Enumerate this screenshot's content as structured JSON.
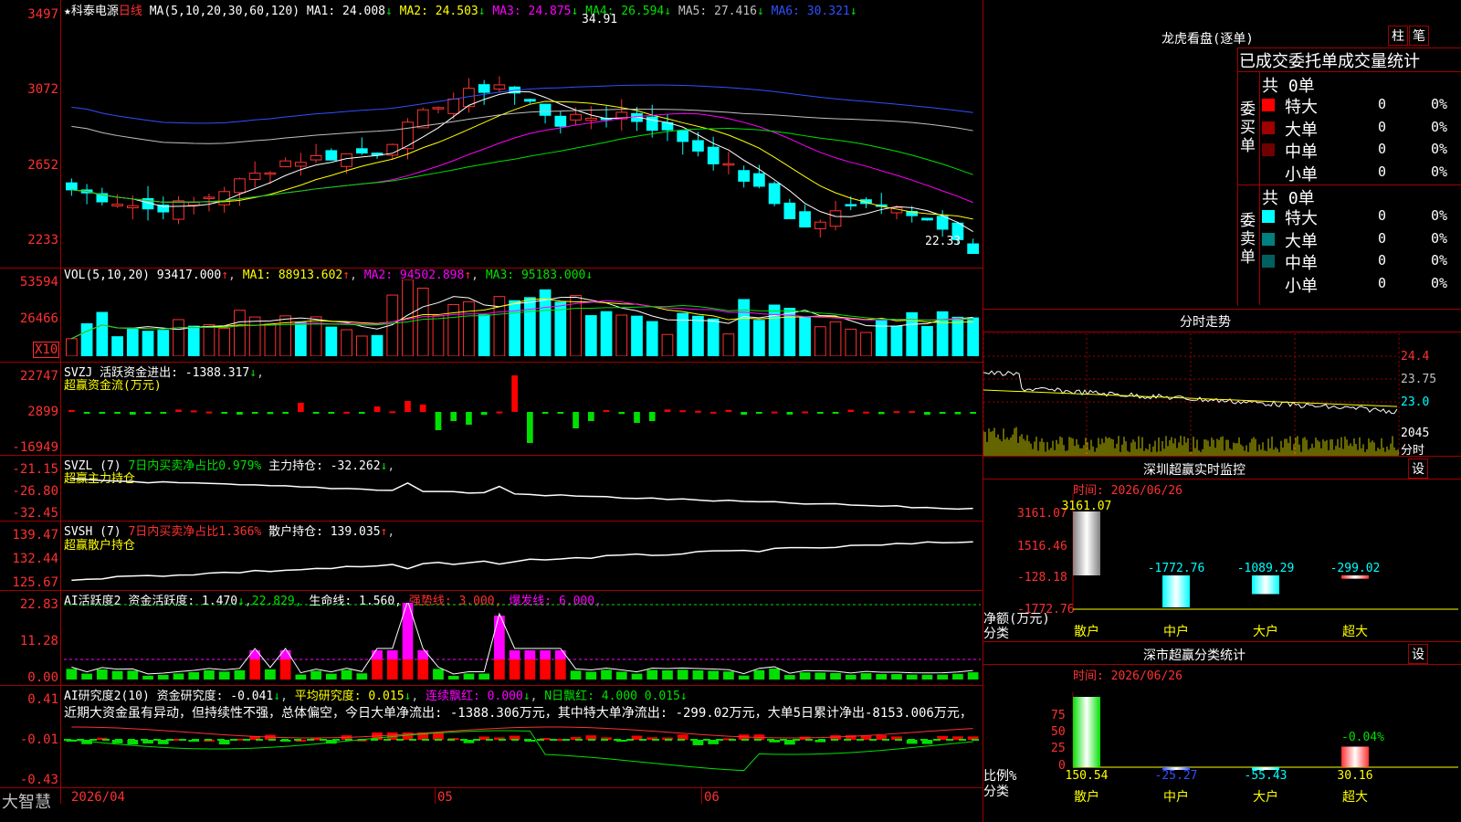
{
  "main_chart": {
    "title_star": "★",
    "stock_name": "科泰电源",
    "period": "日线",
    "ma_label": "MA(5,10,20,30,60,120)",
    "ma_values": [
      {
        "label": "MA1: 24.008",
        "arrow": "↓",
        "color": "#ffffff"
      },
      {
        "label": "MA2: 24.503",
        "arrow": "↓",
        "color": "#ffff00"
      },
      {
        "label": "MA3: 24.875",
        "arrow": "↓",
        "color": "#ff00ff"
      },
      {
        "label": "MA4: 26.594",
        "arrow": "↓",
        "color": "#00e000"
      },
      {
        "label": "MA5: 27.416",
        "arrow": "↓",
        "color": "#c0c0c0"
      },
      {
        "label": "MA6: 30.321",
        "arrow": "↓",
        "color": "#3050ff"
      }
    ],
    "y_ticks": [
      "3497",
      "3072",
      "2652",
      "2233"
    ],
    "high_label": "34.91",
    "low_label": "22.33"
  },
  "vol_pane": {
    "title": "VOL(5,10,20)",
    "value": "93417.000",
    "ma1": "MA1: 88913.602",
    "ma2": "MA2: 94502.898",
    "ma3": "MA3: 95183.000",
    "y_ticks": [
      "53594",
      "26466"
    ],
    "unit": "X10"
  },
  "svzj_pane": {
    "title": "SVZJ",
    "line1": "活跃资金进出: -1388.317",
    "line2": "超赢资金流(万元)",
    "y_ticks": [
      "22747",
      "2899",
      "-16949"
    ]
  },
  "svzl_pane": {
    "title": "SVZL (7)",
    "ratio": "7日内买卖净占比0.979%",
    "hold": "主力持仓: -32.262",
    "line2": "超赢主力持仓",
    "y_ticks": [
      "-21.15",
      "-26.80",
      "-32.45"
    ]
  },
  "svsh_pane": {
    "title": "SVSH (7)",
    "ratio": "7日内买卖净占比1.366%",
    "hold": "散户持仓: 139.035",
    "line2": "超赢散户持仓",
    "y_ticks": [
      "139.47",
      "132.44",
      "125.67"
    ]
  },
  "ai_active_pane": {
    "title": "AI活跃度2",
    "val1": "资金活跃度: 1.470",
    "val2": "22.829,",
    "val3": "生命线: 1.560,",
    "val4": "强势线: 3.000,",
    "val5": "爆发线: 6.000,",
    "y_ticks": [
      "22.83",
      "11.28",
      "0.00"
    ]
  },
  "ai_research_pane": {
    "title": "AI研究度2(10)",
    "val1": "资金研究度: -0.041",
    "val2": "平均研究度: 0.015",
    "val3": "连续飘红: 0.000",
    "val4": "N日飘红: 4.000",
    "val5": "0.015",
    "comment": "近期大资金虽有异动，但持续性不强，总体偏空，今日大单净流出: -1388.306万元，其中特大单净流出: -299.02万元，大单5日累计净出-8153.006万元，",
    "y_ticks": [
      "0.41",
      "-0.01",
      "-0.43"
    ]
  },
  "bottom_axis": {
    "brand": "大智慧",
    "dates": [
      "2026/04",
      "05",
      "06"
    ]
  },
  "longhu": {
    "title": "龙虎看盘(逐单)",
    "btn1": "柱",
    "btn2": "笔",
    "header": "已成交委托单成交量统计",
    "buy_total": "共 0单",
    "buy_side": "委买单",
    "sell_total": "共 0单",
    "sell_side": "委卖单",
    "buy_rows": [
      {
        "label": "特大",
        "color": "#ff0000",
        "qty": "0",
        "pct": "0%"
      },
      {
        "label": "大单",
        "color": "#a00000",
        "qty": "0",
        "pct": "0%"
      },
      {
        "label": "中单",
        "color": "#700000",
        "qty": "0",
        "pct": "0%"
      },
      {
        "label": "小单",
        "color": "",
        "qty": "0",
        "pct": "0%"
      }
    ],
    "sell_rows": [
      {
        "label": "特大",
        "color": "#00ffff",
        "qty": "0",
        "pct": "0%"
      },
      {
        "label": "大单",
        "color": "#008080",
        "qty": "0",
        "pct": "0%"
      },
      {
        "label": "中单",
        "color": "#006060",
        "qty": "0",
        "pct": "0%"
      },
      {
        "label": "小单",
        "color": "",
        "qty": "0",
        "pct": "0%"
      }
    ]
  },
  "intraday": {
    "title": "分时走势",
    "prices": [
      "24.4",
      "23.75",
      "23.0"
    ],
    "vol_label": "2045",
    "vol_unit": "分时"
  },
  "sz_monitor": {
    "title": "深圳超赢实时监控",
    "btn": "设",
    "time": "时间: 2026/06/26",
    "y_ticks": [
      "3161.07",
      "1516.46",
      "-128.18",
      "-1772.76"
    ],
    "ylabel1": "净额(万元)",
    "ylabel2": "分类",
    "categories": [
      "散户",
      "中户",
      "大户",
      "超大"
    ]
  },
  "sz_class": {
    "title": "深市超赢分类统计",
    "btn": "设",
    "time": "时间: 2026/06/26",
    "y_ticks": [
      "75",
      "50",
      "25",
      "0"
    ],
    "ylabel1": "比例%",
    "ylabel2": "分类",
    "above_label": "-0.04%",
    "categories": [
      "散户",
      "中户",
      "大户",
      "超大"
    ]
  },
  "chart_data": [
    {
      "type": "bar",
      "title": "深圳超赢实时监控",
      "categories": [
        "散户",
        "中户",
        "大户",
        "超大"
      ],
      "values": [
        3161.07,
        -1772.76,
        -1089.29,
        -299.02
      ],
      "value_labels": [
        "3161.07",
        "-1772.76",
        "-1089.29",
        "-299.02"
      ],
      "ylabel": "净额(万元)",
      "ylim": [
        -1772.76,
        3161.07
      ]
    },
    {
      "type": "bar",
      "title": "深市超赢分类统计",
      "categories": [
        "散户",
        "中户",
        "大户",
        "超大"
      ],
      "values": [
        150.54,
        -25.27,
        -55.43,
        30.16
      ],
      "value_labels": [
        "150.54",
        "-25.27",
        "-55.43",
        "30.16"
      ],
      "ylabel": "比例%",
      "ylim": [
        0,
        75
      ]
    }
  ]
}
